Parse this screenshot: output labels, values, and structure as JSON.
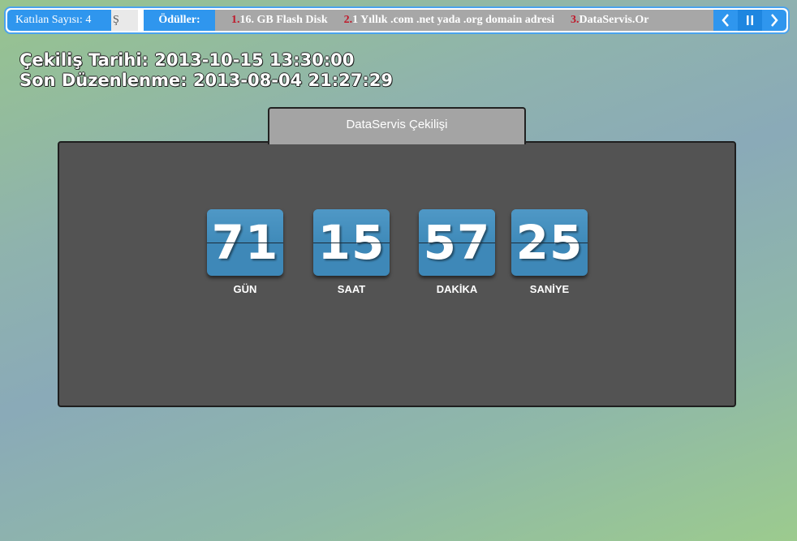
{
  "ticker": {
    "count_label": "Katılan Sayısı: 4",
    "fade_text": "Ş",
    "prizes_label": "Ödüller:",
    "prizes": [
      {
        "num": "1.",
        "text": "16. GB Flash Disk"
      },
      {
        "num": "2.",
        "text": "1 Yıllık .com .net yada .org domain adresi"
      },
      {
        "num": "3.",
        "text": "DataServis.Or"
      }
    ],
    "controls": {
      "prev": "chevron-left-icon",
      "pause": "pause-icon",
      "next": "chevron-right-icon"
    }
  },
  "dates": {
    "draw_date": "Çekiliş Tarihi: 2013-10-15 13:30:00",
    "last_edit": "Son Düzenlenme: 2013-08-04 21:27:29"
  },
  "panel": {
    "tab_title": "DataServis Çekilişi",
    "countdown": [
      {
        "value": "71",
        "label": "GÜN"
      },
      {
        "value": "15",
        "label": "SAAT"
      },
      {
        "value": "57",
        "label": "DAKİKA"
      },
      {
        "value": "25",
        "label": "SANİYE"
      }
    ]
  },
  "colors": {
    "accent": "#2f96ee",
    "prize_number": "#c0182a",
    "flip_card": "#3e88b8",
    "panel": "#535353"
  }
}
